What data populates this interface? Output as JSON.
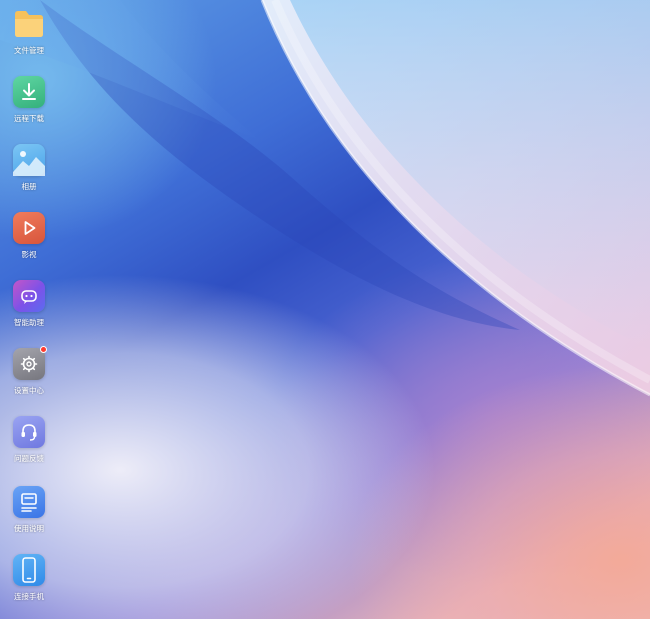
{
  "desktop": {
    "apps": [
      {
        "label": "文件管理",
        "icon": "folder-icon"
      },
      {
        "label": "远程下载",
        "icon": "download-icon"
      },
      {
        "label": "相册",
        "icon": "photo-icon"
      },
      {
        "label": "影视",
        "icon": "play-icon"
      },
      {
        "label": "智能助理",
        "icon": "assistant-icon"
      },
      {
        "label": "设置中心",
        "icon": "gear-icon",
        "badge": true
      },
      {
        "label": "问题反馈",
        "icon": "headset-icon"
      },
      {
        "label": "使用说明",
        "icon": "manual-icon"
      },
      {
        "label": "连接手机",
        "icon": "phone-icon"
      }
    ],
    "colors": {
      "folder": "#f6c15b",
      "download": "#3fbf8a",
      "photo": "#5ab2ee",
      "play": "#e2664a",
      "assistant": "#8a5ce6",
      "settings": "#8e8e96",
      "feedback": "#7b86e6",
      "manual": "#4a86f0",
      "phone": "#3f9cf2",
      "badge": "#ff3b30"
    }
  }
}
